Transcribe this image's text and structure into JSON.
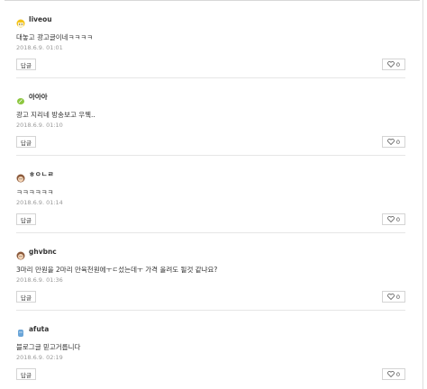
{
  "comments": [
    {
      "nickname": "liveou",
      "avatar_icon": "yellow-face-icon",
      "text": "대놓고 광고글이네ㅋㅋㅋㅋ",
      "date": "2018.6.9. 01:01",
      "reply_label": "답글",
      "like_count": "0"
    },
    {
      "nickname": "아아아",
      "avatar_icon": "green-leaf-icon",
      "text": "광고 지리네 방송보고 우웩..",
      "date": "2018.6.9. 01:10",
      "reply_label": "답글",
      "like_count": "0"
    },
    {
      "nickname": "ㅎㅇㄴㄹ",
      "avatar_icon": "brown-face-icon",
      "text": "ㅋㅋㅋㅋㅋㅋ",
      "date": "2018.6.9. 01:14",
      "reply_label": "답글",
      "like_count": "0"
    },
    {
      "nickname": "ghvbnc",
      "avatar_icon": "brown-face-icon",
      "text": "3마리 만원을 2마리 만육천원에ㅜㄷ섰는데ㅜ 가격 올려도 될것 같냐요?",
      "date": "2018.6.9. 01:36",
      "reply_label": "답글",
      "like_count": "0"
    },
    {
      "nickname": "afuta",
      "avatar_icon": "blue-figure-icon",
      "text": "블로그글 믿고거릅니다",
      "date": "2018.6.9. 02:19",
      "reply_label": "답글",
      "like_count": "0"
    }
  ],
  "colors": {
    "text": "#333333",
    "date": "#9a9a9a",
    "border": "#d4d4d4",
    "separator": "#e6e6e6"
  }
}
